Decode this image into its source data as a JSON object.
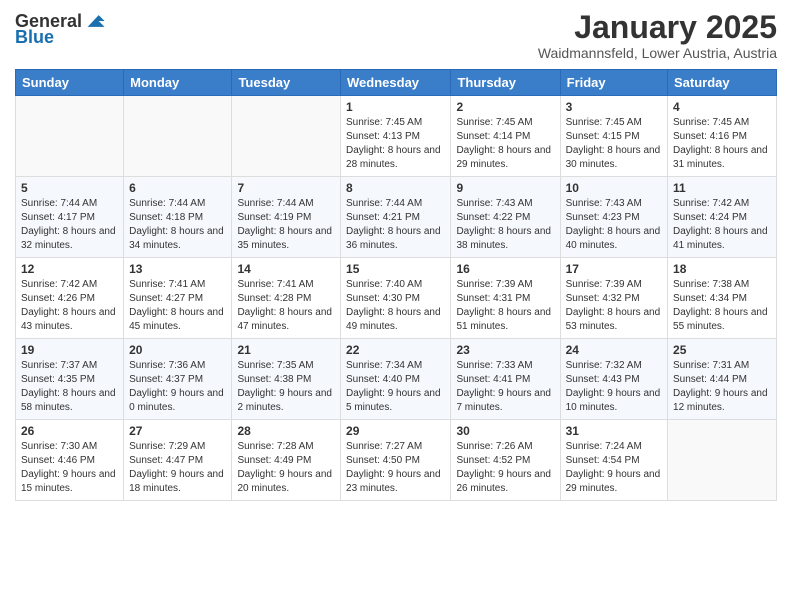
{
  "header": {
    "logo_general": "General",
    "logo_blue": "Blue",
    "month": "January 2025",
    "location": "Waidmannsfeld, Lower Austria, Austria"
  },
  "days_of_week": [
    "Sunday",
    "Monday",
    "Tuesday",
    "Wednesday",
    "Thursday",
    "Friday",
    "Saturday"
  ],
  "weeks": [
    [
      {
        "day": "",
        "info": ""
      },
      {
        "day": "",
        "info": ""
      },
      {
        "day": "",
        "info": ""
      },
      {
        "day": "1",
        "info": "Sunrise: 7:45 AM\nSunset: 4:13 PM\nDaylight: 8 hours and 28 minutes."
      },
      {
        "day": "2",
        "info": "Sunrise: 7:45 AM\nSunset: 4:14 PM\nDaylight: 8 hours and 29 minutes."
      },
      {
        "day": "3",
        "info": "Sunrise: 7:45 AM\nSunset: 4:15 PM\nDaylight: 8 hours and 30 minutes."
      },
      {
        "day": "4",
        "info": "Sunrise: 7:45 AM\nSunset: 4:16 PM\nDaylight: 8 hours and 31 minutes."
      }
    ],
    [
      {
        "day": "5",
        "info": "Sunrise: 7:44 AM\nSunset: 4:17 PM\nDaylight: 8 hours and 32 minutes."
      },
      {
        "day": "6",
        "info": "Sunrise: 7:44 AM\nSunset: 4:18 PM\nDaylight: 8 hours and 34 minutes."
      },
      {
        "day": "7",
        "info": "Sunrise: 7:44 AM\nSunset: 4:19 PM\nDaylight: 8 hours and 35 minutes."
      },
      {
        "day": "8",
        "info": "Sunrise: 7:44 AM\nSunset: 4:21 PM\nDaylight: 8 hours and 36 minutes."
      },
      {
        "day": "9",
        "info": "Sunrise: 7:43 AM\nSunset: 4:22 PM\nDaylight: 8 hours and 38 minutes."
      },
      {
        "day": "10",
        "info": "Sunrise: 7:43 AM\nSunset: 4:23 PM\nDaylight: 8 hours and 40 minutes."
      },
      {
        "day": "11",
        "info": "Sunrise: 7:42 AM\nSunset: 4:24 PM\nDaylight: 8 hours and 41 minutes."
      }
    ],
    [
      {
        "day": "12",
        "info": "Sunrise: 7:42 AM\nSunset: 4:26 PM\nDaylight: 8 hours and 43 minutes."
      },
      {
        "day": "13",
        "info": "Sunrise: 7:41 AM\nSunset: 4:27 PM\nDaylight: 8 hours and 45 minutes."
      },
      {
        "day": "14",
        "info": "Sunrise: 7:41 AM\nSunset: 4:28 PM\nDaylight: 8 hours and 47 minutes."
      },
      {
        "day": "15",
        "info": "Sunrise: 7:40 AM\nSunset: 4:30 PM\nDaylight: 8 hours and 49 minutes."
      },
      {
        "day": "16",
        "info": "Sunrise: 7:39 AM\nSunset: 4:31 PM\nDaylight: 8 hours and 51 minutes."
      },
      {
        "day": "17",
        "info": "Sunrise: 7:39 AM\nSunset: 4:32 PM\nDaylight: 8 hours and 53 minutes."
      },
      {
        "day": "18",
        "info": "Sunrise: 7:38 AM\nSunset: 4:34 PM\nDaylight: 8 hours and 55 minutes."
      }
    ],
    [
      {
        "day": "19",
        "info": "Sunrise: 7:37 AM\nSunset: 4:35 PM\nDaylight: 8 hours and 58 minutes."
      },
      {
        "day": "20",
        "info": "Sunrise: 7:36 AM\nSunset: 4:37 PM\nDaylight: 9 hours and 0 minutes."
      },
      {
        "day": "21",
        "info": "Sunrise: 7:35 AM\nSunset: 4:38 PM\nDaylight: 9 hours and 2 minutes."
      },
      {
        "day": "22",
        "info": "Sunrise: 7:34 AM\nSunset: 4:40 PM\nDaylight: 9 hours and 5 minutes."
      },
      {
        "day": "23",
        "info": "Sunrise: 7:33 AM\nSunset: 4:41 PM\nDaylight: 9 hours and 7 minutes."
      },
      {
        "day": "24",
        "info": "Sunrise: 7:32 AM\nSunset: 4:43 PM\nDaylight: 9 hours and 10 minutes."
      },
      {
        "day": "25",
        "info": "Sunrise: 7:31 AM\nSunset: 4:44 PM\nDaylight: 9 hours and 12 minutes."
      }
    ],
    [
      {
        "day": "26",
        "info": "Sunrise: 7:30 AM\nSunset: 4:46 PM\nDaylight: 9 hours and 15 minutes."
      },
      {
        "day": "27",
        "info": "Sunrise: 7:29 AM\nSunset: 4:47 PM\nDaylight: 9 hours and 18 minutes."
      },
      {
        "day": "28",
        "info": "Sunrise: 7:28 AM\nSunset: 4:49 PM\nDaylight: 9 hours and 20 minutes."
      },
      {
        "day": "29",
        "info": "Sunrise: 7:27 AM\nSunset: 4:50 PM\nDaylight: 9 hours and 23 minutes."
      },
      {
        "day": "30",
        "info": "Sunrise: 7:26 AM\nSunset: 4:52 PM\nDaylight: 9 hours and 26 minutes."
      },
      {
        "day": "31",
        "info": "Sunrise: 7:24 AM\nSunset: 4:54 PM\nDaylight: 9 hours and 29 minutes."
      },
      {
        "day": "",
        "info": ""
      }
    ]
  ]
}
